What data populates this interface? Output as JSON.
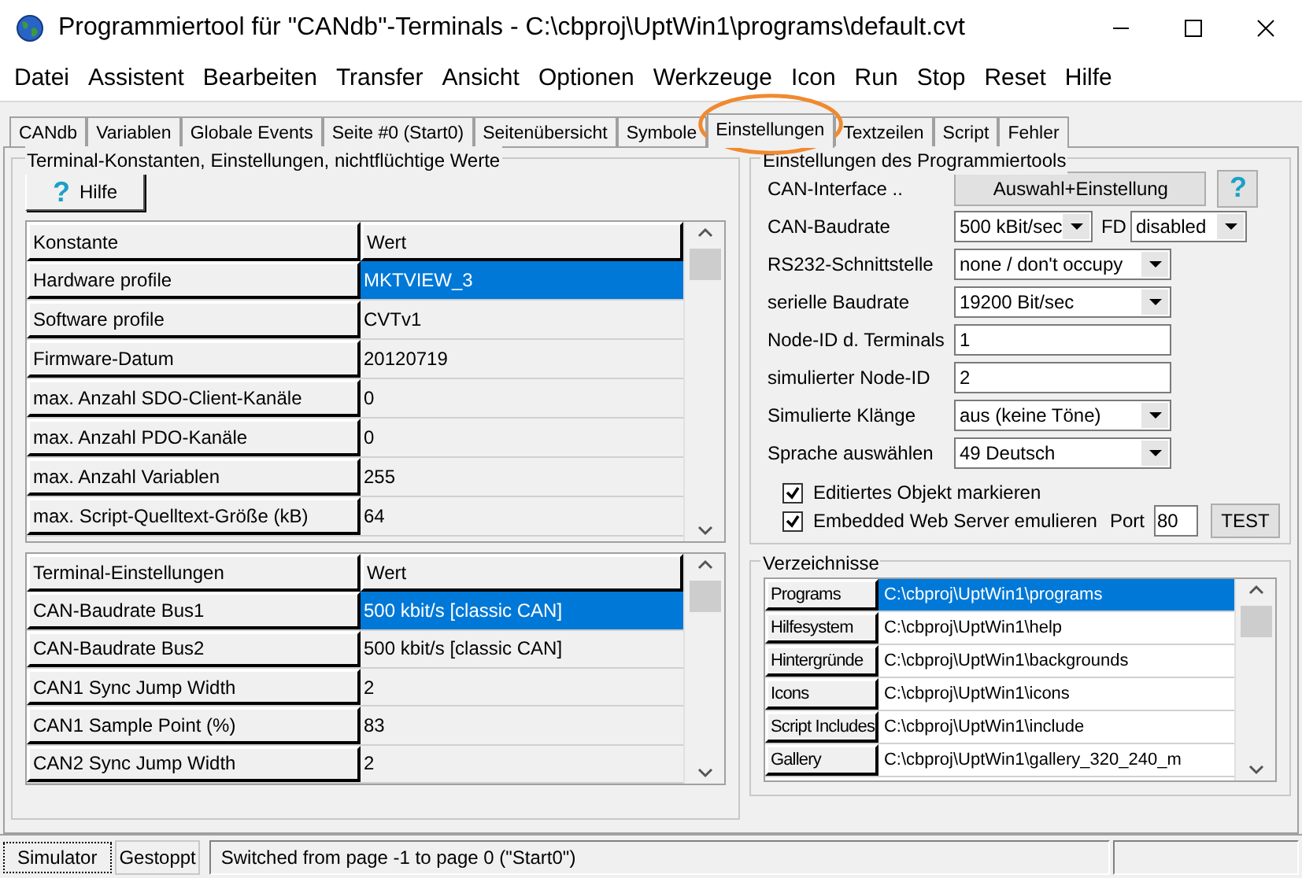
{
  "window": {
    "title": "Programmiertool für \"CANdb\"-Terminals - C:\\cbproj\\UptWin1\\programs\\default.cvt"
  },
  "menu": [
    "Datei",
    "Assistent",
    "Bearbeiten",
    "Transfer",
    "Ansicht",
    "Optionen",
    "Werkzeuge",
    "Icon",
    "Run",
    "Stop",
    "Reset",
    "Hilfe"
  ],
  "tabs": [
    {
      "label": "CANdb",
      "selected": false
    },
    {
      "label": "Variablen",
      "selected": false
    },
    {
      "label": "Globale Events",
      "selected": false
    },
    {
      "label": "Seite #0 (Start0)",
      "selected": false
    },
    {
      "label": "Seitenübersicht",
      "selected": false
    },
    {
      "label": "Symbole",
      "selected": false
    },
    {
      "label": "Einstellungen",
      "selected": true
    },
    {
      "label": "Textzeilen",
      "selected": false
    },
    {
      "label": "Script",
      "selected": false
    },
    {
      "label": "Fehler",
      "selected": false
    }
  ],
  "terminal_group": {
    "title": "Terminal-Konstanten, Einstellungen, nichtflüchtige Werte",
    "help_button": {
      "icon": "?",
      "label": "Hilfe"
    },
    "constants_table": {
      "columns": [
        "Konstante",
        "Wert"
      ],
      "rows": [
        {
          "name": "Hardware profile",
          "value": "MKTVIEW_3",
          "selected": true
        },
        {
          "name": "Software profile",
          "value": "CVTv1",
          "selected": false
        },
        {
          "name": "Firmware-Datum",
          "value": "20120719",
          "selected": false
        },
        {
          "name": "max. Anzahl SDO-Client-Kanäle",
          "value": "0",
          "selected": false
        },
        {
          "name": "max. Anzahl PDO-Kanäle",
          "value": "0",
          "selected": false
        },
        {
          "name": "max. Anzahl Variablen",
          "value": "255",
          "selected": false
        },
        {
          "name": "max. Script-Quelltext-Größe (kB)",
          "value": "64",
          "selected": false
        }
      ]
    },
    "settings_table": {
      "columns": [
        "Terminal-Einstellungen",
        "Wert"
      ],
      "rows": [
        {
          "name": "CAN-Baudrate Bus1",
          "value": "500 kbit/s [classic CAN]",
          "selected": true
        },
        {
          "name": "CAN-Baudrate Bus2",
          "value": "500 kbit/s [classic CAN]",
          "selected": false
        },
        {
          "name": "CAN1 Sync Jump Width",
          "value": "2",
          "selected": false
        },
        {
          "name": "CAN1 Sample Point (%)",
          "value": "83",
          "selected": false
        },
        {
          "name": "CAN2 Sync Jump Width",
          "value": "2",
          "selected": false
        }
      ]
    }
  },
  "tool_settings": {
    "title": "Einstellungen des Programmiertools",
    "fields": [
      {
        "kind": "button",
        "label": "CAN-Interface ..",
        "value": "Auswahl+Einstellung",
        "icon": "?"
      },
      {
        "kind": "dropdown_pair",
        "label": "CAN-Baudrate",
        "value": "500 kBit/sec",
        "second_label": "FD",
        "second_value": "disabled"
      },
      {
        "kind": "dropdown",
        "label": "RS232-Schnittstelle",
        "value": "none / don't occupy"
      },
      {
        "kind": "dropdown",
        "label": "serielle Baudrate",
        "value": "19200 Bit/sec"
      },
      {
        "kind": "input",
        "label": "Node-ID d. Terminals",
        "value": "1"
      },
      {
        "kind": "input",
        "label": "simulierter Node-ID",
        "value": "2"
      },
      {
        "kind": "dropdown",
        "label": "Simulierte Klänge",
        "value": "aus (keine Töne)"
      },
      {
        "kind": "dropdown",
        "label": "Sprache auswählen",
        "value": "49 Deutsch"
      }
    ],
    "checkboxes": [
      {
        "label": "Editiertes Objekt markieren",
        "checked": true
      },
      {
        "label": "Embedded Web Server emulieren",
        "checked": true,
        "port_label": "Port",
        "port_value": "80",
        "button": "TEST"
      }
    ]
  },
  "directories": {
    "title": "Verzeichnisse",
    "rows": [
      {
        "name": "Programs",
        "path": "C:\\cbproj\\UptWin1\\programs",
        "selected": true
      },
      {
        "name": "Hilfesystem",
        "path": "C:\\cbproj\\UptWin1\\help",
        "selected": false
      },
      {
        "name": "Hintergründe",
        "path": "C:\\cbproj\\UptWin1\\backgrounds",
        "selected": false
      },
      {
        "name": "Icons",
        "path": "C:\\cbproj\\UptWin1\\icons",
        "selected": false
      },
      {
        "name": "Script Includes",
        "path": "C:\\cbproj\\UptWin1\\include",
        "selected": false
      },
      {
        "name": "Gallery",
        "path": "C:\\cbproj\\UptWin1\\gallery_320_240_m",
        "selected": false
      }
    ]
  },
  "status_bar": {
    "simulator_button": "Simulator",
    "state": "Gestoppt",
    "message": "Switched from page -1  to page  0 (\"Start0\")"
  }
}
